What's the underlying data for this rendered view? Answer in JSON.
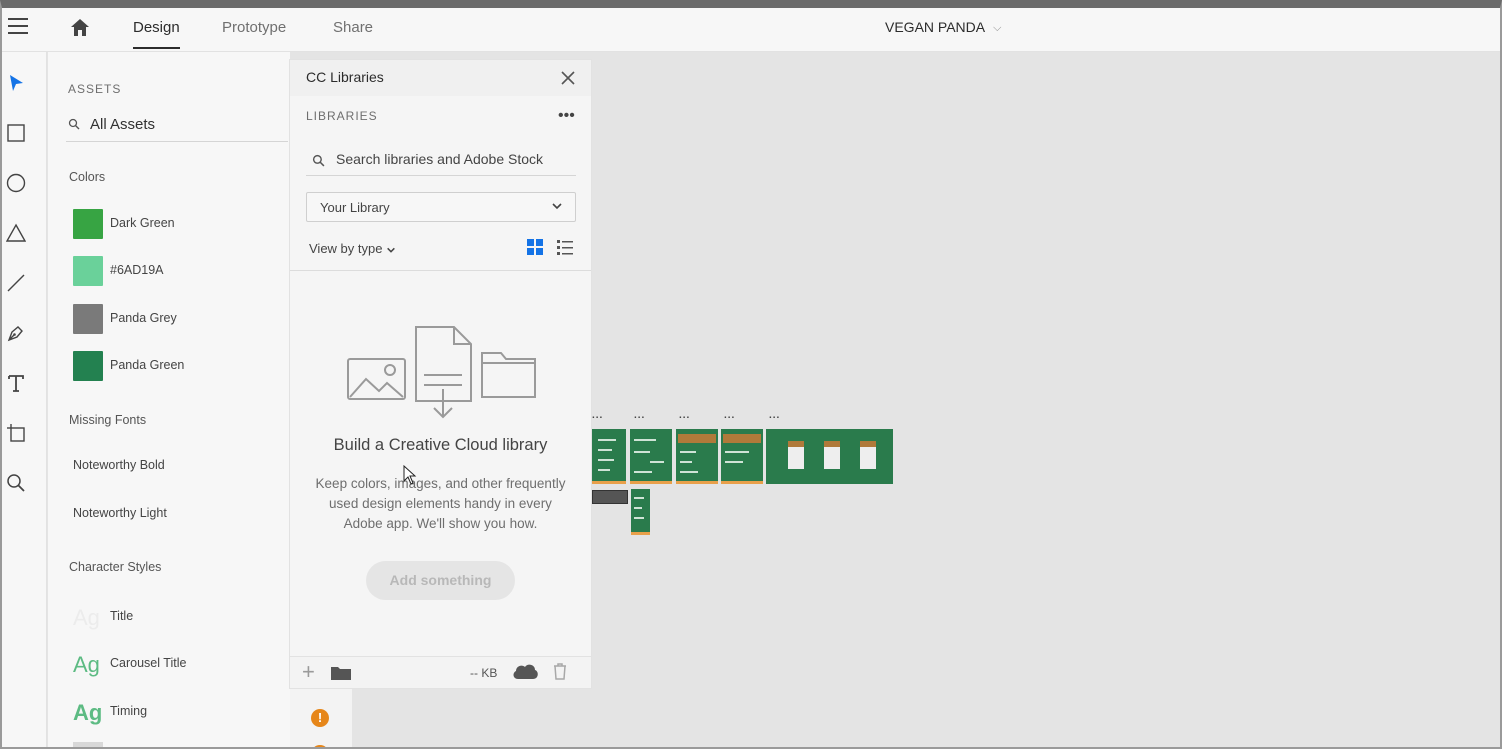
{
  "header": {
    "tabs": [
      {
        "label": "Design",
        "active": true
      },
      {
        "label": "Prototype",
        "active": false
      },
      {
        "label": "Share",
        "active": false
      }
    ],
    "document_title": "VEGAN PANDA"
  },
  "toolbar": {
    "tools": [
      "select-tool",
      "rectangle-tool",
      "ellipse-tool",
      "polygon-tool",
      "line-tool",
      "pen-tool",
      "text-tool",
      "artboard-tool",
      "zoom-tool"
    ]
  },
  "assets": {
    "heading": "ASSETS",
    "search_value": "All Assets",
    "colors_label": "Colors",
    "colors": [
      {
        "name": "Dark Green",
        "hex": "#37a443"
      },
      {
        "name": "#6AD19A",
        "hex": "#6ad19a"
      },
      {
        "name": "Panda Grey",
        "hex": "#7a7a7a"
      },
      {
        "name": "Panda Green",
        "hex": "#238150"
      }
    ],
    "missing_fonts_label": "Missing Fonts",
    "fonts": [
      "Noteworthy Bold",
      "Noteworthy Light"
    ],
    "char_styles_label": "Character Styles",
    "char_styles": [
      {
        "sample": "Ag",
        "name": "Title",
        "color": "#efefef"
      },
      {
        "sample": "Ag",
        "name": "Carousel Title",
        "color": "#6ac48e"
      },
      {
        "sample": "Ag",
        "name": "Timing",
        "color": "#6ac48e"
      }
    ]
  },
  "cc_libraries": {
    "title": "CC Libraries",
    "section_label": "LIBRARIES",
    "search_placeholder": "Search libraries and Adobe Stock",
    "library_select": "Your Library",
    "view_by": "View by type",
    "empty_title": "Build a Creative Cloud library",
    "empty_desc": "Keep colors, images, and other frequently used design elements handy in every Adobe app. We'll show you how.",
    "add_button": "Add something",
    "storage": "-- KB"
  },
  "canvas": {
    "artboard_label": "..."
  },
  "colors": {
    "accent_blue": "#1473e6",
    "artboard_green": "#2a7b4c",
    "warning_orange": "#e68619"
  }
}
